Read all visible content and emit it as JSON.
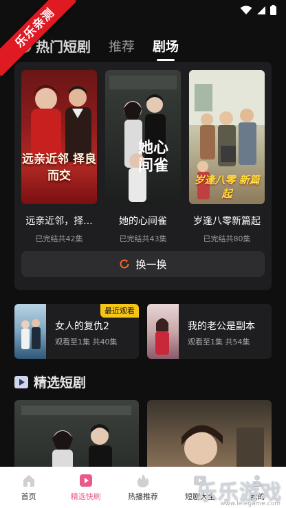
{
  "ribbon": {
    "text": "乐乐亲测"
  },
  "tabs": [
    {
      "label": "热门短剧"
    },
    {
      "label": "推荐"
    },
    {
      "label": "剧场"
    }
  ],
  "theater": {
    "posters": [
      {
        "title": "远亲近邻，择...",
        "subtitle": "已完结共42集",
        "art_text": "远亲近邻 择良而交"
      },
      {
        "title": "她的心间雀",
        "subtitle": "已完结共43集",
        "art_text": "她心间雀"
      },
      {
        "title": "岁逢八零新篇起",
        "subtitle": "已完结共80集",
        "art_text": "岁逢八零 新篇起"
      }
    ],
    "refresh_label": "换一换"
  },
  "recent": [
    {
      "title": "女人的复仇2",
      "subtitle": "观看至1集 共40集",
      "badge": "最近观看"
    },
    {
      "title": "我的老公是副本",
      "subtitle": "观看至1集 共54集"
    }
  ],
  "section": {
    "title": "精选短剧"
  },
  "bottom_nav": [
    {
      "label": "首页",
      "icon": "home-icon"
    },
    {
      "label": "精选快刷",
      "icon": "play-icon"
    },
    {
      "label": "热播推荐",
      "icon": "fire-icon"
    },
    {
      "label": "短剧大全",
      "icon": "video-icon"
    },
    {
      "label": "我的",
      "icon": "user-icon"
    }
  ],
  "watermark": {
    "text": "乐乐游戏",
    "sub": "www.lelegame.com"
  },
  "colors": {
    "accent": "#e85a8c",
    "badge": "#f5c518",
    "refresh_icon": "#ff6a2b"
  }
}
